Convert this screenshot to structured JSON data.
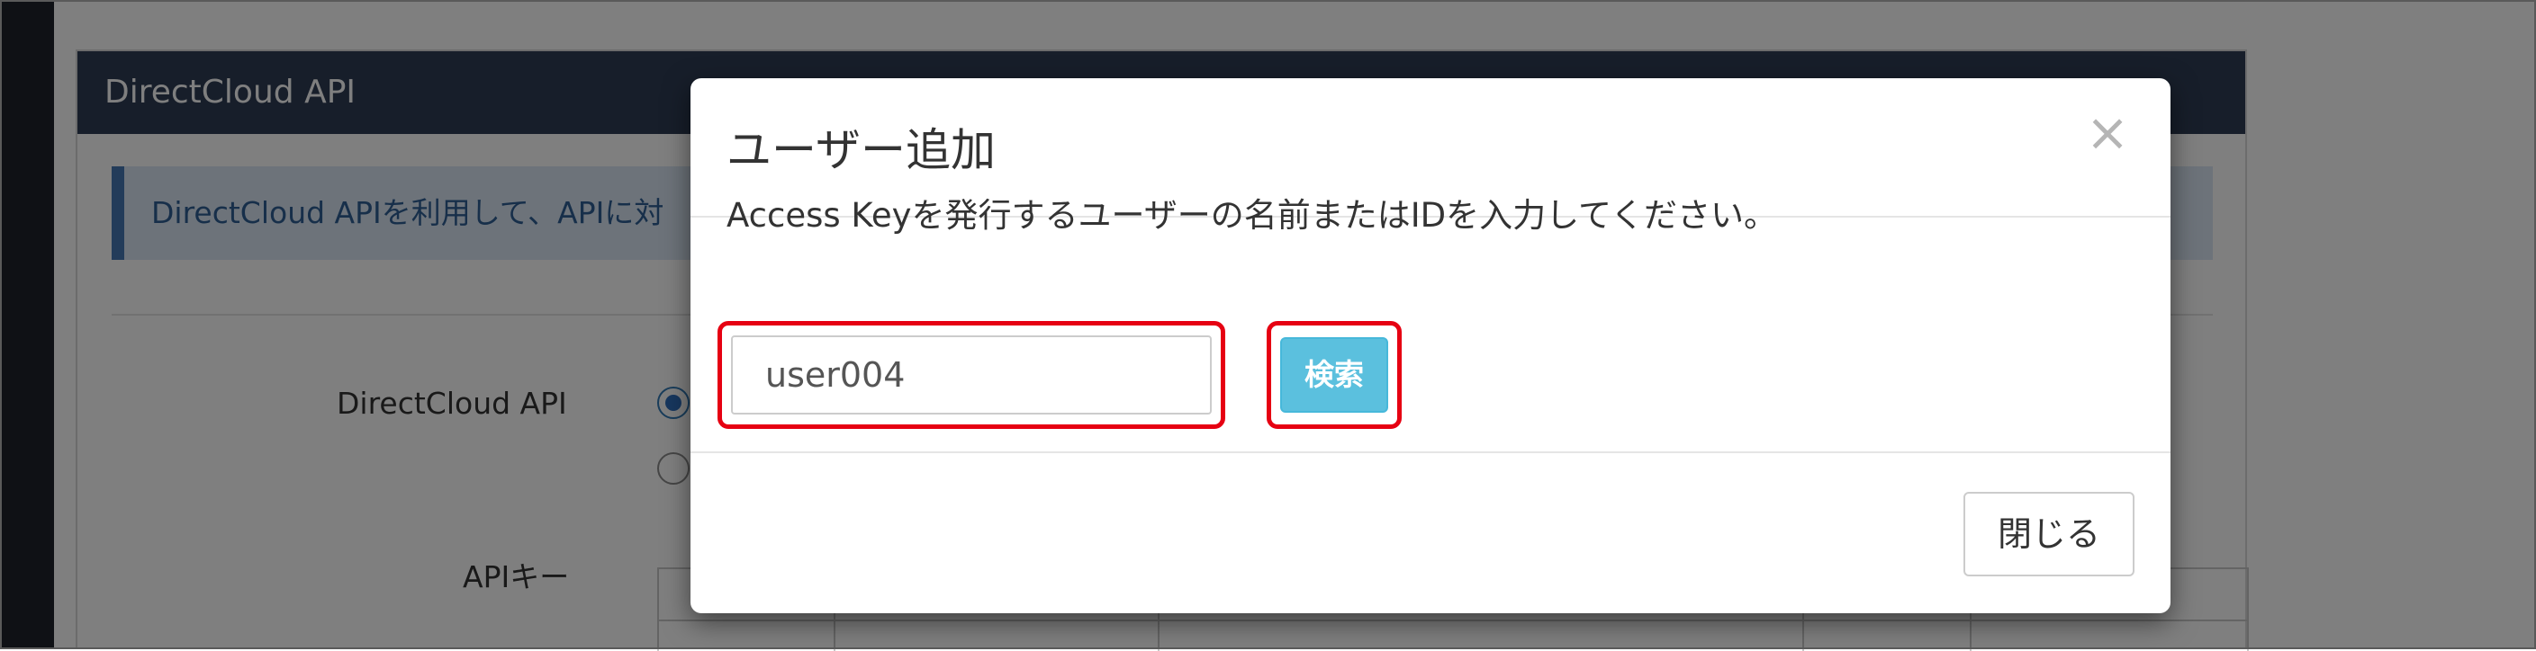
{
  "background_page": {
    "panel_title": "DirectCloud API",
    "info_text": "DirectCloud APIを利用して、APIに対",
    "form": {
      "api_label": "DirectCloud API",
      "api_key_label": "APIキー"
    }
  },
  "modal": {
    "title": "ユーザー追加",
    "close_symbol": "×",
    "instruction": "Access Keyを発行するユーザーの名前またはIDを入力してください。",
    "search_input_value": "user004",
    "search_button_label": "検索",
    "footer_close_label": "閉じる"
  },
  "colors": {
    "highlight_border": "#e60012",
    "search_button": "#5bc0de",
    "panel_header": "#2e3c55"
  },
  "icons": {
    "close": "close-icon"
  }
}
